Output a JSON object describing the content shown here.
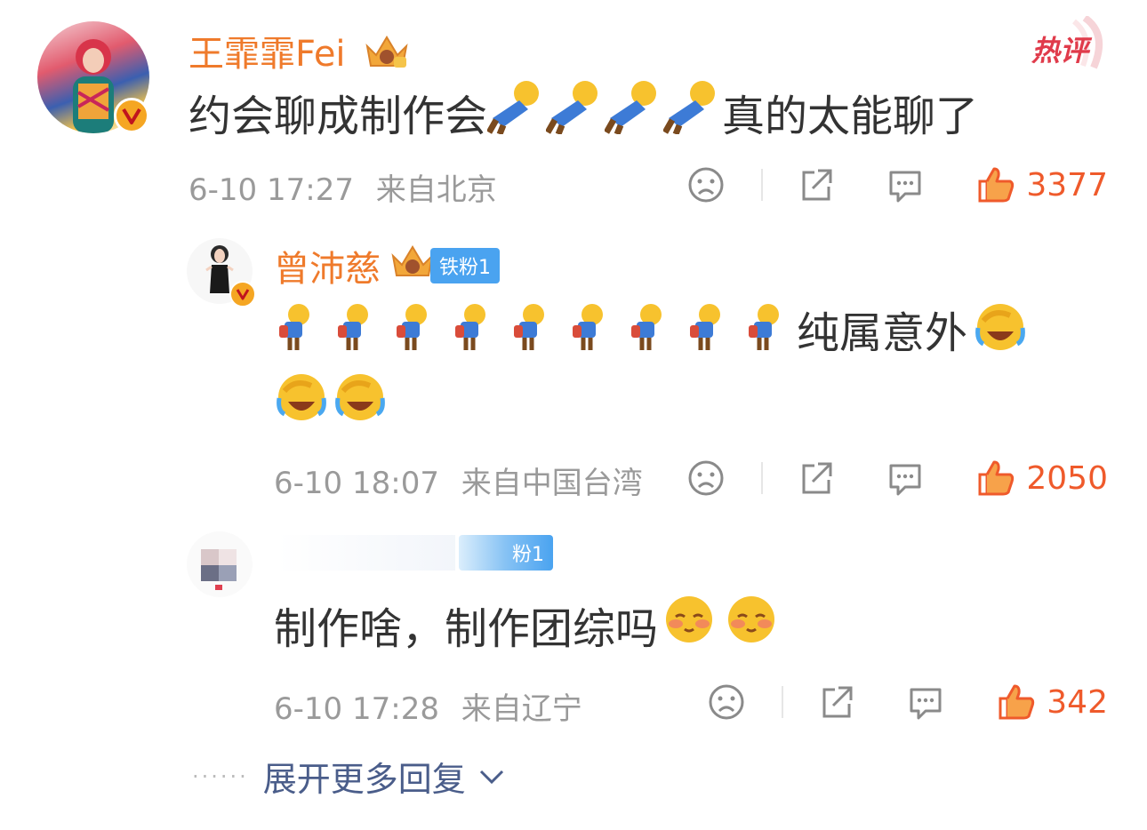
{
  "comments": [
    {
      "user": "王霏霏Fei",
      "text_before": "约会聊成制作会",
      "text_after": "真的太能聊了",
      "time": "6-10 17:27",
      "location": "来自北京",
      "likes": "3377"
    },
    {
      "user": "曾沛慈",
      "fan_badge": "铁粉1",
      "text_after": "纯属意外",
      "time": "6-10 18:07",
      "location": "来自中国台湾",
      "likes": "2050"
    },
    {
      "fan_badge": "粉1",
      "text": "制作啥，制作团综吗",
      "time": "6-10 17:28",
      "location": "来自辽宁",
      "likes": "342"
    }
  ],
  "hot_badge_label": "热评",
  "expand_more": "展开更多回复",
  "colors": {
    "username": "#ef7a2b",
    "like": "#ef5a2b",
    "meta": "#9a9a9a",
    "link": "#4a5d8a",
    "badge_blue": "#4aa3f0"
  },
  "icons": [
    "dislike-face-icon",
    "share-icon",
    "comment-icon",
    "thumbs-up-icon",
    "crown-icon",
    "verified-icon",
    "chevron-down-icon"
  ]
}
